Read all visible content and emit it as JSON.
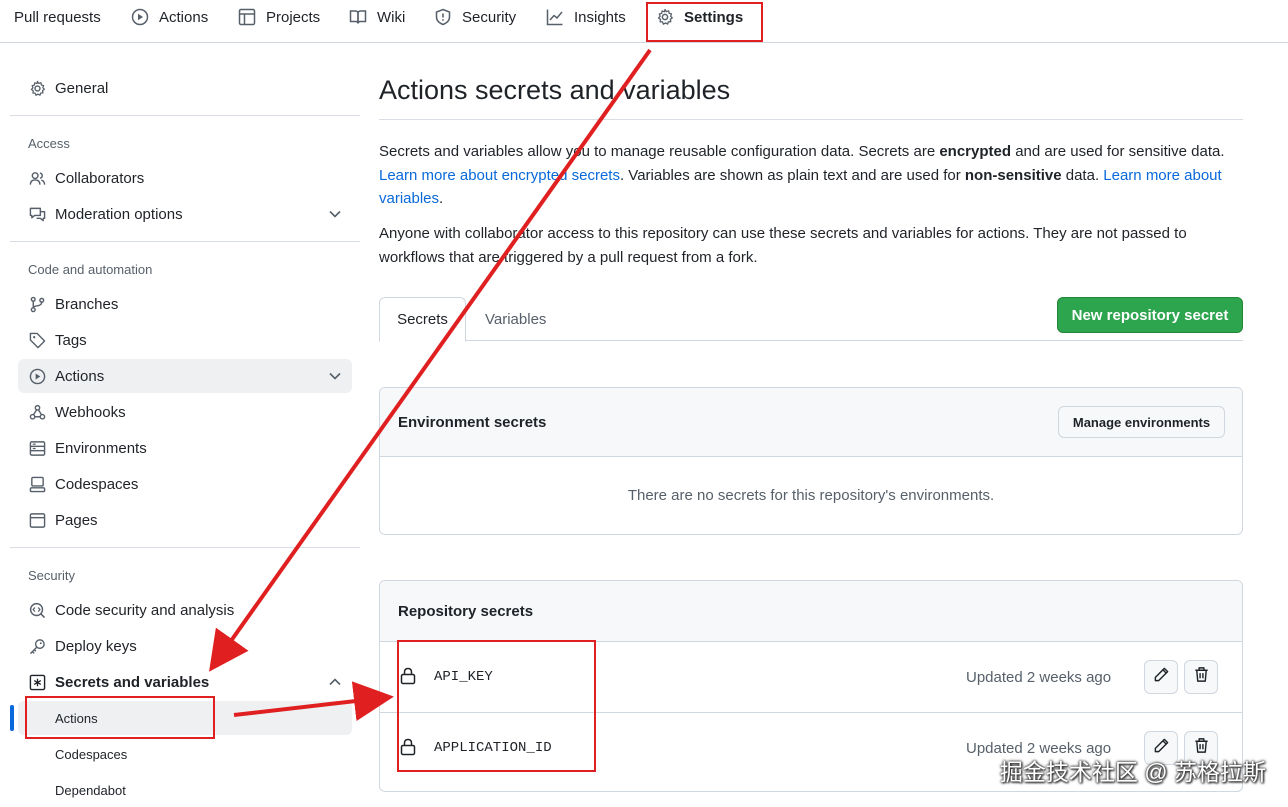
{
  "topnav": {
    "tabs": [
      {
        "label": "Pull requests",
        "icon": "pull-request-icon"
      },
      {
        "label": "Actions",
        "icon": "play-icon"
      },
      {
        "label": "Projects",
        "icon": "table-icon"
      },
      {
        "label": "Wiki",
        "icon": "book-icon"
      },
      {
        "label": "Security",
        "icon": "shield-icon"
      },
      {
        "label": "Insights",
        "icon": "graph-icon"
      },
      {
        "label": "Settings",
        "icon": "gear-icon",
        "active": true
      }
    ]
  },
  "sidebar": {
    "general": "General",
    "sections": {
      "access": "Access",
      "code_automation": "Code and automation",
      "security": "Security"
    },
    "items": {
      "collaborators": "Collaborators",
      "moderation": "Moderation options",
      "branches": "Branches",
      "tags": "Tags",
      "actions": "Actions",
      "webhooks": "Webhooks",
      "environments": "Environments",
      "codespaces": "Codespaces",
      "pages": "Pages",
      "code_security": "Code security and analysis",
      "deploy_keys": "Deploy keys",
      "secrets_vars": "Secrets and variables"
    },
    "subitems": {
      "actions": "Actions",
      "codespaces": "Codespaces",
      "dependabot": "Dependabot"
    }
  },
  "main": {
    "title": "Actions secrets and variables",
    "intro": {
      "p1_a": "Secrets and variables allow you to manage reusable configuration data. Secrets are ",
      "p1_b": "encrypted",
      "p1_c": " and are used for sensitive data. ",
      "p1_link1": "Learn more about encrypted secrets",
      "p1_d": ". Variables are shown as plain text and are used for ",
      "p1_e": "non-sensitive",
      "p1_f": " data. ",
      "p1_link2": "Learn more about variables",
      "p1_g": ".",
      "p2": "Anyone with collaborator access to this repository can use these secrets and variables for actions. They are not passed to workflows that are triggered by a pull request from a fork."
    },
    "tabs": {
      "secrets": "Secrets",
      "variables": "Variables"
    },
    "new_secret_button": "New repository secret",
    "env_secrets": {
      "heading": "Environment secrets",
      "manage_button": "Manage environments",
      "empty": "There are no secrets for this repository's environments."
    },
    "repo_secrets": {
      "heading": "Repository secrets",
      "rows": [
        {
          "name": "API_KEY",
          "updated": "Updated 2 weeks ago"
        },
        {
          "name": "APPLICATION_ID",
          "updated": "Updated 2 weeks ago"
        }
      ]
    }
  },
  "annotation_color": "#e02020",
  "watermark": "掘金技术社区 @ 苏格拉斯"
}
